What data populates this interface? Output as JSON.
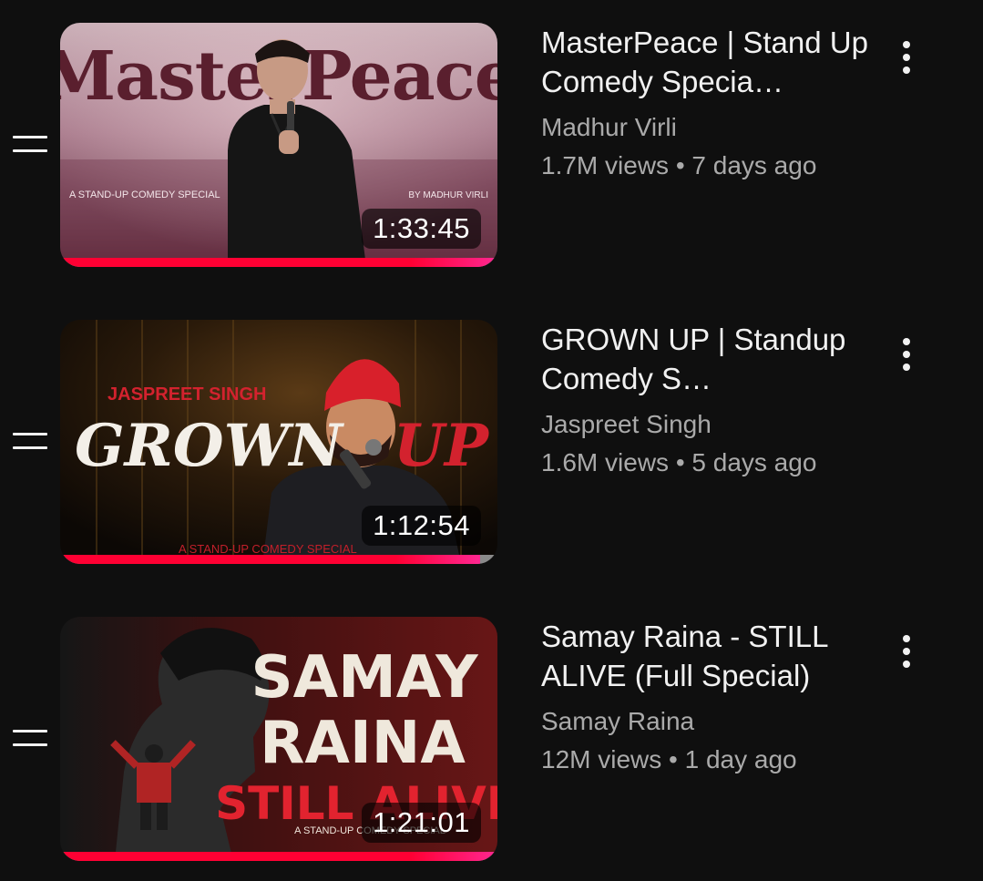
{
  "playlist": {
    "items": [
      {
        "title": "MasterPeace | Stand Up Comedy Specia…",
        "channel": "Madhur Virli",
        "stats": "1.7M views • 7 days ago",
        "duration": "1:33:45",
        "watch_progress": 1.0,
        "thumbnail": {
          "headline": "MasterPeace",
          "tagline": "A STAND-UP COMEDY SPECIAL",
          "credit": "BY MADHUR VIRLI"
        }
      },
      {
        "title": "GROWN UP | Standup Comedy S…",
        "channel": "Jaspreet Singh",
        "stats": "1.6M views • 5 days ago",
        "duration": "1:12:54",
        "watch_progress": 0.96,
        "thumbnail": {
          "name": "JASPREET SINGH",
          "headline_a": "GROWN",
          "headline_b": "UP",
          "tagline": "A STAND-UP COMEDY SPECIAL"
        }
      },
      {
        "title": "Samay Raina - STILL ALIVE (Full Special)",
        "channel": "Samay Raina",
        "stats": "12M views • 1 day ago",
        "duration": "1:21:01",
        "watch_progress": 1.0,
        "thumbnail": {
          "line1": "SAMAY",
          "line2": "RAINA",
          "line3": "STILL ALIVE",
          "tagline": "A STAND-UP COMEDY SPECIAL"
        }
      }
    ]
  },
  "icons": {
    "drag": "drag-handle-icon",
    "more": "more-vert-icon"
  },
  "colors": {
    "background": "#0f0f0f",
    "progress": "#ff0033",
    "title": "#f1f1f1",
    "secondary": "#aaaaaa"
  }
}
